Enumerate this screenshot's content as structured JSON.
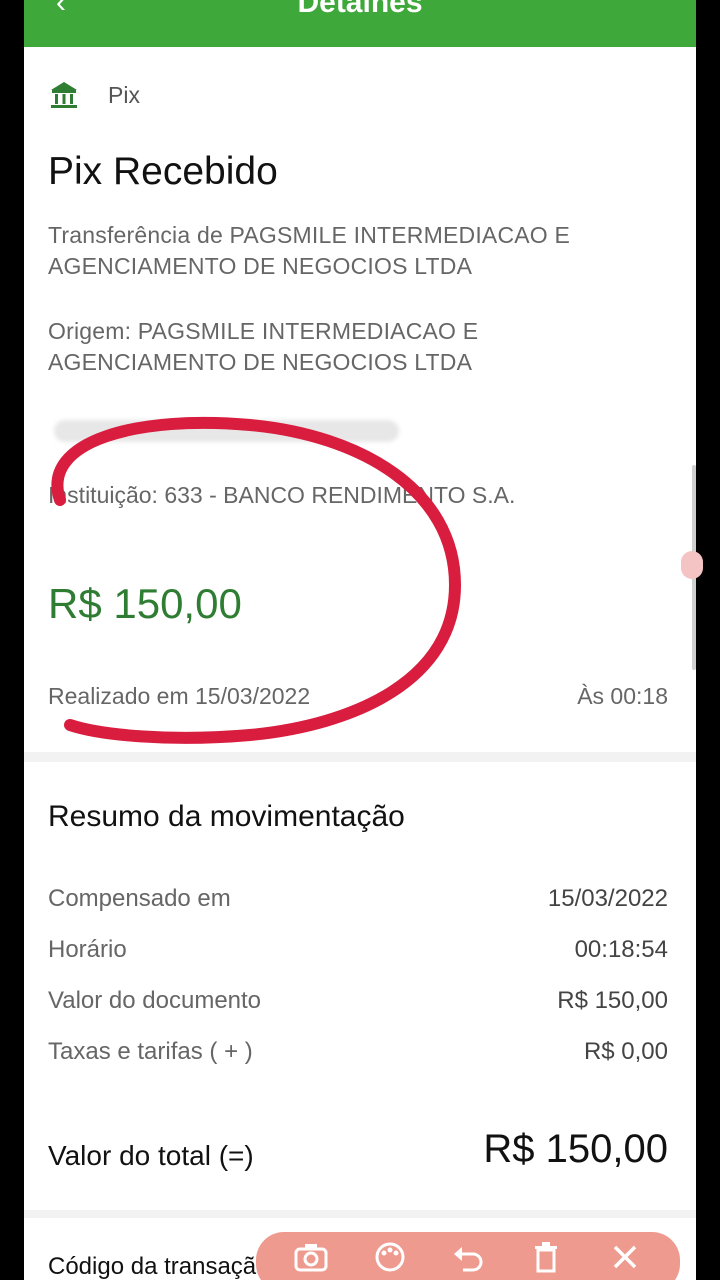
{
  "header": {
    "title": "Detalhes",
    "back_icon": "back-arrow-icon"
  },
  "breadcrumb": {
    "icon": "bank-icon",
    "label": "Pix"
  },
  "transaction": {
    "title": "Pix Recebido",
    "transfer": "Transferência de PAGSMILE INTERMEDIACAO E AGENCIAMENTO DE NEGOCIOS LTDA",
    "origin": "Origem: PAGSMILE INTERMEDIACAO E AGENCIAMENTO DE NEGOCIOS LTDA",
    "institution": "Instituição: 633 - BANCO RENDIMENTO S.A.",
    "amount": "R$ 150,00",
    "realized": "Realizado em 15/03/2022",
    "time": "Às 00:18"
  },
  "summary": {
    "title": "Resumo da movimentação",
    "rows": [
      {
        "label": "Compensado em",
        "value": "15/03/2022"
      },
      {
        "label": "Horário",
        "value": "00:18:54"
      },
      {
        "label": "Valor do documento",
        "value": "R$ 150,00"
      },
      {
        "label": "Taxas e tarifas ( + )",
        "value": "R$ 0,00"
      }
    ],
    "total_label": "Valor do total (=)",
    "total_value": "R$ 150,00",
    "code_label": "Código da transação"
  },
  "annotation_toolbar": {
    "tools": [
      "camera-icon",
      "palette-icon",
      "undo-icon",
      "trash-icon",
      "close-icon"
    ]
  },
  "colors": {
    "brand_green": "#3ea83a",
    "amount_green": "#2f7d32",
    "annotation_red": "#d81d3f"
  }
}
